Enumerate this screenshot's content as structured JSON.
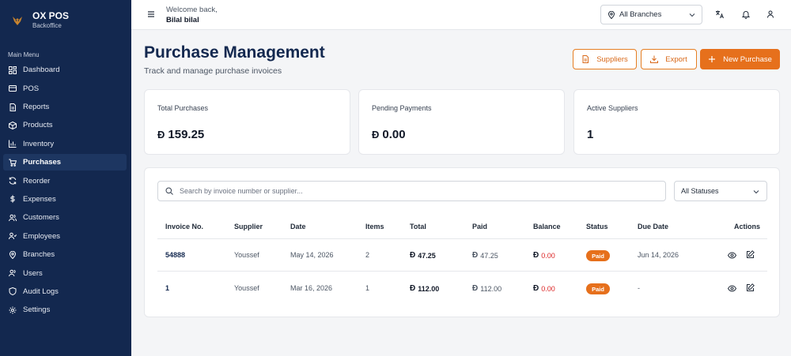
{
  "colors": {
    "sidebar_bg": "#13284f",
    "accent": "#e6701c",
    "negative": "#dc2626",
    "page_bg": "#f4f5f7"
  },
  "brand": {
    "name": "OX POS",
    "subtitle": "Backoffice",
    "icon": "ox-logo-icon"
  },
  "sidebar": {
    "menu_title": "Main Menu",
    "items": [
      {
        "label": "Dashboard",
        "icon": "dashboard-icon"
      },
      {
        "label": "POS",
        "icon": "pos-icon"
      },
      {
        "label": "Reports",
        "icon": "reports-icon"
      },
      {
        "label": "Products",
        "icon": "box-icon"
      },
      {
        "label": "Inventory",
        "icon": "bar-chart-icon"
      },
      {
        "label": "Purchases",
        "icon": "cart-icon",
        "active": true
      },
      {
        "label": "Reorder",
        "icon": "refresh-icon"
      },
      {
        "label": "Expenses",
        "icon": "dollar-icon"
      },
      {
        "label": "Customers",
        "icon": "customers-icon"
      },
      {
        "label": "Employees",
        "icon": "employees-icon"
      },
      {
        "label": "Branches",
        "icon": "map-pin-icon"
      },
      {
        "label": "Users",
        "icon": "users-icon"
      },
      {
        "label": "Audit Logs",
        "icon": "shield-icon"
      },
      {
        "label": "Settings",
        "icon": "gear-icon"
      }
    ]
  },
  "header": {
    "welcome": "Welcome back,",
    "username": "Bilal bilal",
    "branch_select": "All Branches",
    "icons": [
      "translate-icon",
      "bell-icon",
      "user-icon"
    ]
  },
  "page": {
    "title": "Purchase Management",
    "subtitle": "Track and manage purchase invoices",
    "buttons": {
      "suppliers": "Suppliers",
      "export": "Export",
      "new_purchase": "New Purchase"
    }
  },
  "currency_symbol": "Ð",
  "stats": [
    {
      "label": "Total Purchases",
      "value": "159.25",
      "currency": true
    },
    {
      "label": "Pending Payments",
      "value": "0.00",
      "currency": true
    },
    {
      "label": "Active Suppliers",
      "value": "1",
      "currency": false
    }
  ],
  "filters": {
    "search_placeholder": "Search by invoice number or supplier...",
    "status": "All Statuses"
  },
  "table": {
    "columns": [
      "Invoice No.",
      "Supplier",
      "Date",
      "Items",
      "Total",
      "Paid",
      "Balance",
      "Status",
      "Due Date",
      "Actions"
    ],
    "rows": [
      {
        "invoice": "54888",
        "supplier": "Youssef",
        "date": "May 14, 2026",
        "items": "2",
        "total": "47.25",
        "paid": "47.25",
        "balance": "0.00",
        "status": "Paid",
        "due_date": "Jun 14, 2026"
      },
      {
        "invoice": "1",
        "supplier": "Youssef",
        "date": "Mar 16, 2026",
        "items": "1",
        "total": "112.00",
        "paid": "112.00",
        "balance": "0.00",
        "status": "Paid",
        "due_date": "-"
      }
    ]
  }
}
